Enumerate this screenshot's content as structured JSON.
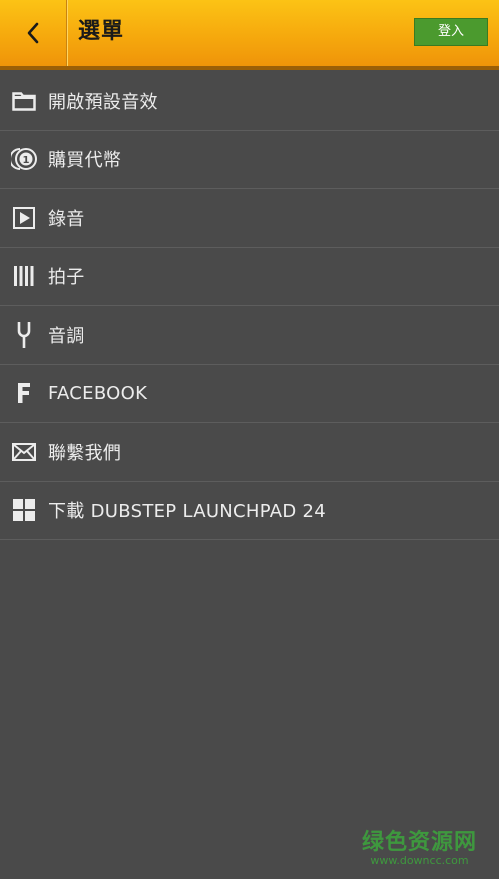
{
  "header": {
    "back_icon": "chevron-left-icon",
    "title": "選單",
    "login_label": "登入",
    "bg_color": "#f6a90d",
    "login_color": "#4b9a2e"
  },
  "menu": {
    "items": [
      {
        "label": "開啟預設音效",
        "icon": "folder-icon"
      },
      {
        "label": "購買代幣",
        "icon": "coin-icon"
      },
      {
        "label": "錄音",
        "icon": "play-icon"
      },
      {
        "label": "拍子",
        "icon": "bars-icon"
      },
      {
        "label": "音調",
        "icon": "tuning-fork-icon"
      },
      {
        "label": "FACEBOOK",
        "icon": "facebook-icon"
      },
      {
        "label": "聯繫我們",
        "icon": "mail-icon"
      },
      {
        "label": "下載 DUBSTEP LAUNCHPAD 24",
        "icon": "windows-icon"
      }
    ]
  },
  "watermark": {
    "main": "绿色资源网",
    "sub": "www.downcc.com"
  }
}
